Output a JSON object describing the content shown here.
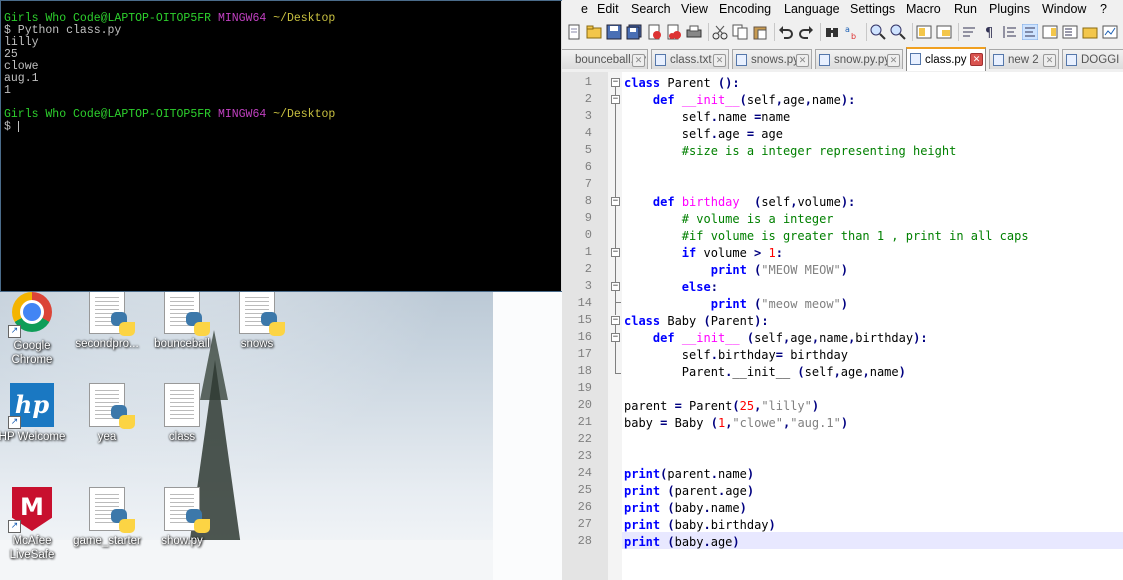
{
  "desktop": {
    "icons": [
      {
        "label": "Google Chrome",
        "icon": "chrome-icon"
      },
      {
        "label": "secondpro...",
        "icon": "python-file-icon"
      },
      {
        "label": "bounceball",
        "icon": "python-file-icon"
      },
      {
        "label": "snows",
        "icon": "python-file-icon"
      },
      {
        "label": "HP Welcome",
        "icon": "hp-icon"
      },
      {
        "label": "yea",
        "icon": "python-file-icon"
      },
      {
        "label": "class",
        "icon": "text-file-icon"
      },
      {
        "label": "McAfee LiveSafe",
        "icon": "mcafee-icon"
      },
      {
        "label": "game_starter",
        "icon": "python-file-icon"
      },
      {
        "label": "show.py",
        "icon": "python-file-icon"
      }
    ]
  },
  "terminal": {
    "prompt_user": "Girls Who Code@LAPTOP-OITOP5FR",
    "prompt_env": "MINGW64",
    "prompt_path": "~/Desktop",
    "command": "$ Python class.py",
    "output": [
      "lilly",
      "25",
      "clowe",
      "aug.1",
      "1"
    ],
    "input_prompt": "$ "
  },
  "notepadpp": {
    "menu": [
      "e",
      "Edit",
      "Search",
      "View",
      "Encoding",
      "Language",
      "Settings",
      "Macro",
      "Run",
      "Plugins",
      "Window",
      "?"
    ],
    "tabs": [
      {
        "label": "bounceball.py",
        "active": false
      },
      {
        "label": "class.txt",
        "active": false
      },
      {
        "label": "snows.py",
        "active": false
      },
      {
        "label": "snow.py.py",
        "active": false
      },
      {
        "label": "class.py",
        "active": true
      },
      {
        "label": "new 2",
        "active": false
      },
      {
        "label": "DOGGI",
        "active": false
      }
    ],
    "line_numbers": [
      "1",
      "2",
      "3",
      "4",
      "5",
      "6",
      "7",
      "8",
      "9",
      "0",
      "1",
      "2",
      "3",
      "14",
      "15",
      "16",
      "17",
      "18",
      "19",
      "20",
      "21",
      "22",
      "23",
      "24",
      "25",
      "26",
      "27",
      "28"
    ],
    "current_line": 28,
    "code": [
      "class Parent ():",
      "    def __init__(self,age,name):",
      "        self.name =name",
      "        self.age = age",
      "        #size is a integer representing height",
      "",
      "",
      "    def birthday  (self,volume):",
      "        # volume is a integer",
      "        #if volume is greater than 1 , print in all caps",
      "        if volume > 1:",
      "            print (\"MEOW MEOW\")",
      "        else:",
      "            print (\"meow meow\")",
      "class Baby (Parent):",
      "    def __init__ (self,age,name,birthday):",
      "        self.birthday= birthday",
      "        Parent.__init__ (self,age,name)",
      "",
      "parent = Parent(25,\"lilly\")",
      "baby = Baby (1,\"clowe\",\"aug.1\")",
      "",
      "",
      "print(parent.name)",
      "print (parent.age)",
      "print (baby.name)",
      "print (baby.birthday)",
      "print (baby.age)"
    ]
  },
  "colors": {
    "keyword": "#0000ff",
    "function_name": "#ff00ff",
    "number": "#ff0000",
    "string": "#808080",
    "comment": "#008000",
    "terminal_green": "#2dd02d",
    "terminal_magenta": "#c040c0",
    "terminal_yellow": "#c8c040"
  }
}
